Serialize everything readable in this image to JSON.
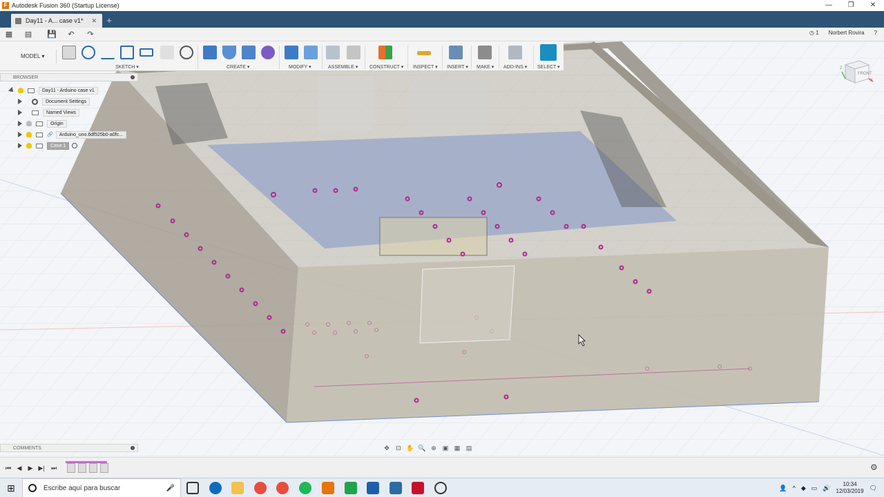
{
  "window": {
    "title": "Autodesk Fusion 360 (Startup License)",
    "controls": [
      "—",
      "❐",
      "✕"
    ]
  },
  "tabs": [
    {
      "label": "Day11 - A... case v1*",
      "close": "✕"
    }
  ],
  "new_tab": "+",
  "qab": {
    "job_status": "1",
    "user": "Norbert Rovira",
    "help": "?"
  },
  "toolbar": {
    "mode": "MODEL",
    "groups": [
      {
        "label": "SKETCH"
      },
      {
        "label": "CREATE"
      },
      {
        "label": "MODIFY"
      },
      {
        "label": "ASSEMBLE"
      },
      {
        "label": "CONSTRUCT"
      },
      {
        "label": "INSPECT"
      },
      {
        "label": "INSERT"
      },
      {
        "label": "MAKE"
      },
      {
        "label": "ADD-INS"
      },
      {
        "label": "SELECT"
      }
    ]
  },
  "browser": {
    "title": "BROWSER",
    "items": [
      {
        "label": "Day11 - Arduino case v1"
      },
      {
        "label": "Document Settings"
      },
      {
        "label": "Named Views"
      },
      {
        "label": "Origin"
      },
      {
        "label": "Arduino_uno.6df525b0-a0fc..."
      },
      {
        "label": "Case:1"
      }
    ]
  },
  "viewcube": {
    "face": "FRONT",
    "axis_x": "X",
    "axis_z": "Z"
  },
  "comments": {
    "title": "COMMENTS"
  },
  "taskbar": {
    "search_placeholder": "Escribe aquí para buscar",
    "time": "10:34",
    "date": "12/03/2019",
    "colors": {
      "edge": "#0f6cbd",
      "folder": "#f2c14e",
      "chrome": "#e84d3d",
      "spotify": "#1db954",
      "fusion": "#e8740c",
      "green": "#1ea44a",
      "vs": "#1c5fa8",
      "c": "#2b6ca3",
      "m": "#c8102e"
    }
  }
}
